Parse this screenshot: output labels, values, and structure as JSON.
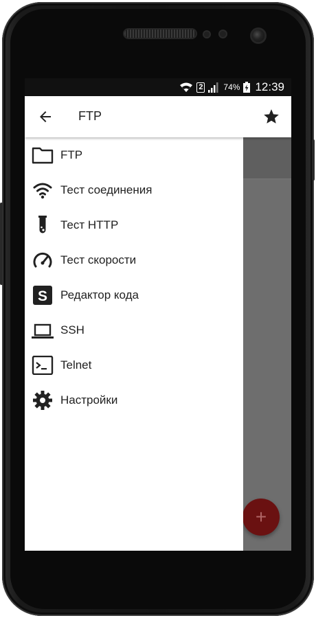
{
  "status_bar": {
    "sim_number": "2",
    "battery_percent": "74%",
    "time": "12:39"
  },
  "app_bar": {
    "title": "FTP"
  },
  "drawer": {
    "items": [
      {
        "label": "FTP",
        "icon": "folder-icon"
      },
      {
        "label": "Тест соединения",
        "icon": "wifi-icon"
      },
      {
        "label": "Тест HTTP",
        "icon": "test-tube-icon"
      },
      {
        "label": "Тест скорости",
        "icon": "speedometer-icon"
      },
      {
        "label": "Редактор кода",
        "icon": "code-editor-icon"
      },
      {
        "label": "SSH",
        "icon": "laptop-icon"
      },
      {
        "label": "Telnet",
        "icon": "console-icon"
      },
      {
        "label": "Настройки",
        "icon": "gear-icon"
      }
    ]
  },
  "fab": {
    "symbol": "+"
  },
  "colors": {
    "fab": "#6a1111",
    "scrim": "#6e6e6e",
    "status_bar": "#111111"
  }
}
